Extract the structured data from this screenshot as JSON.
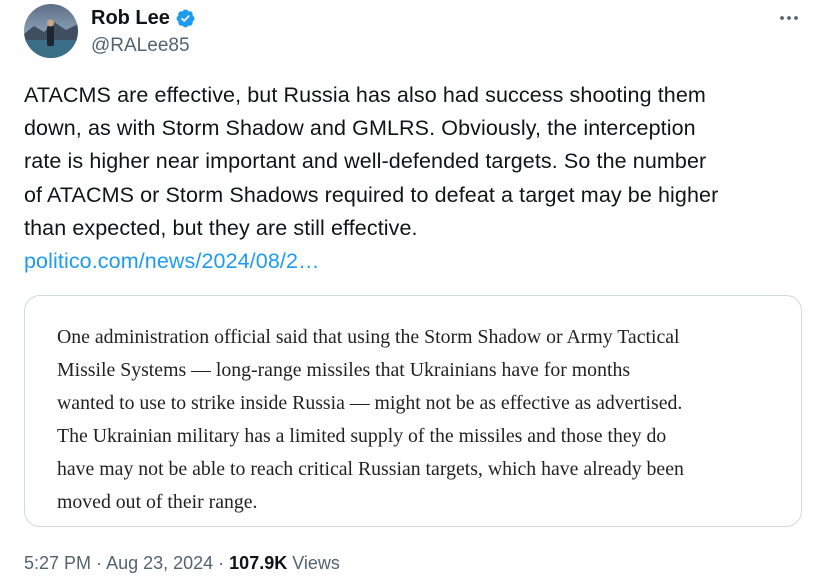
{
  "author": {
    "name": "Rob Lee",
    "handle": "@RALee85",
    "verified": true,
    "avatar": "profile-photo"
  },
  "more_icon": "ellipsis-icon",
  "tweet": {
    "lines": [
      "ATACMS are effective, but Russia has also had success shooting them",
      "down, as with Storm Shadow and GMLRS. Obviously, the interception",
      "rate is higher near important and well-defended targets. So the number",
      "of ATACMS or Storm Shadows required to defeat a target may be higher",
      "than expected, but they are still effective."
    ],
    "link": "politico.com/news/2024/08/2…"
  },
  "quote": {
    "lines": [
      "One administration official said that using the Storm Shadow or Army Tactical",
      "Missile Systems — long-range missiles that Ukrainians have for months",
      "wanted to use to strike inside Russia — might not be as effective as advertised.",
      "The Ukrainian military has a limited supply of the missiles and those they do",
      "have may not be able to reach critical Russian targets, which have already been",
      "moved out of their range."
    ]
  },
  "meta": {
    "time": "5:27 PM",
    "separator": " · ",
    "date": "Aug 23, 2024",
    "views_count": "107.9K",
    "views_label": " Views"
  },
  "colors": {
    "text": "#0f1419",
    "secondary": "#536471",
    "link": "#1d9bf0",
    "verified": "#1d9bf0",
    "border": "#cfd9de"
  }
}
